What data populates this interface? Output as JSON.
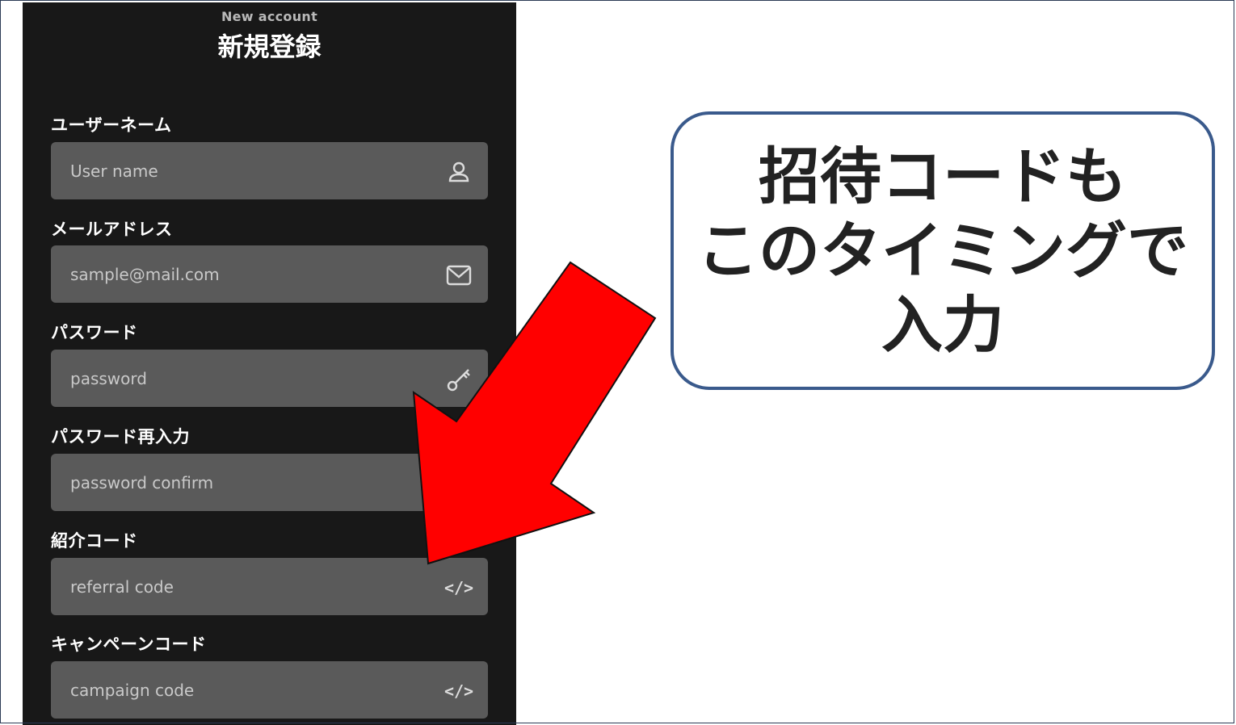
{
  "header": {
    "subtitle": "New account",
    "title": "新規登録"
  },
  "form": {
    "fields": [
      {
        "label": "ユーザーネーム",
        "placeholder": "User name",
        "value": "",
        "icon": "user-icon"
      },
      {
        "label": "メールアドレス",
        "placeholder": "sample@mail.com",
        "value": "",
        "icon": "envelope-icon"
      },
      {
        "label": "パスワード",
        "placeholder": "password",
        "value": "",
        "icon": "key-icon"
      },
      {
        "label": "パスワード再入力",
        "placeholder": "password confirm",
        "value": "",
        "icon": "key-icon"
      },
      {
        "label": "紹介コード",
        "placeholder": "referral code",
        "value": "",
        "icon": "code-icon",
        "icon_text": "</>"
      },
      {
        "label": "キャンペーンコード",
        "placeholder": "campaign code",
        "value": "",
        "icon": "code-icon",
        "icon_text": "</>"
      }
    ]
  },
  "annotation": {
    "lines": [
      "招待コードも",
      "このタイミングで",
      "入力"
    ],
    "arrow_color": "#ff0000",
    "border_color": "#3a5a8c"
  },
  "colors": {
    "panel_bg": "#181818",
    "field_bg": "#5a5a5a"
  }
}
